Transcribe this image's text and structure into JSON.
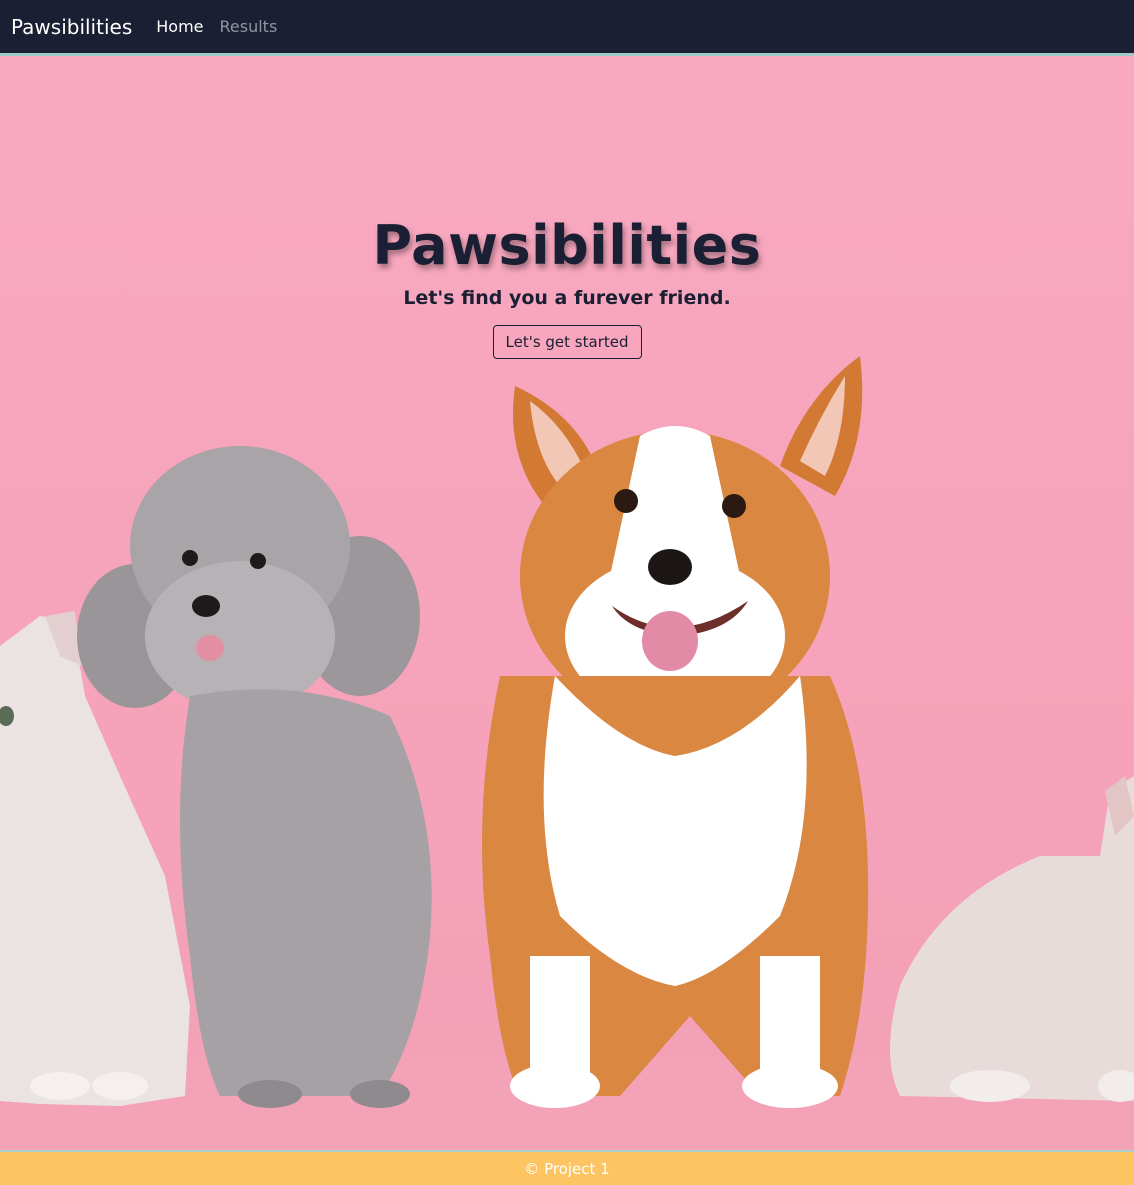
{
  "navbar": {
    "brand": "Pawsibilities",
    "links": [
      {
        "label": "Home",
        "active": true
      },
      {
        "label": "Results",
        "active": false
      }
    ]
  },
  "hero": {
    "title": "Pawsibilities",
    "subtitle": "Let's find you a furever friend.",
    "cta_label": "Let's get started"
  },
  "footer": {
    "text": "© Project 1"
  },
  "colors": {
    "navbar_bg": "#1b1f33",
    "hero_bg": "#f8a8c0",
    "footer_bg": "#fdc462"
  }
}
